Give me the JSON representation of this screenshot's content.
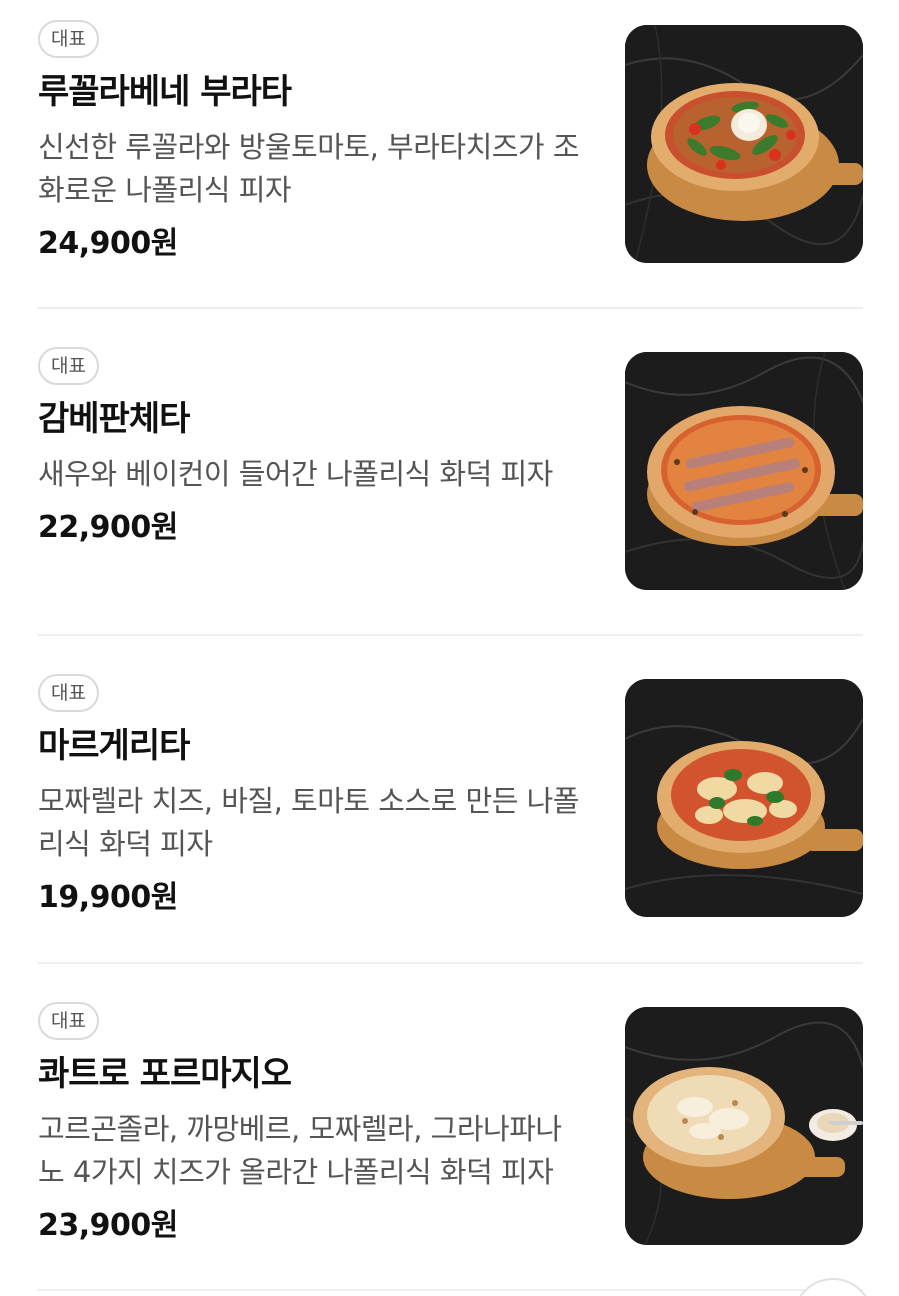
{
  "menu": {
    "items": [
      {
        "badge": "대표",
        "name": "루꼴라베네 부라타",
        "description": "신선한 루꼴라와 방울토마토, 부라타치즈가 조화로운 나폴리식 피자",
        "price": "24,900원",
        "image_icon": "rucola-burrata-pizza-photo"
      },
      {
        "badge": "대표",
        "name": "감베판체타",
        "description": "새우와 베이컨이 들어간 나폴리식 화덕 피자",
        "price": "22,900원",
        "image_icon": "gamberi-pancetta-pizza-photo"
      },
      {
        "badge": "대표",
        "name": "마르게리타",
        "description": "모짜렐라 치즈, 바질, 토마토 소스로 만든 나폴리식 화덕 피자",
        "price": "19,900원",
        "image_icon": "margherita-pizza-photo"
      },
      {
        "badge": "대표",
        "name": "콰트로 포르마지오",
        "description": "고르곤졸라, 까망베르, 모짜렐라, 그라나파나노 4가지 치즈가 올라간 나폴리식 화덕 피자",
        "price": "23,900원",
        "image_icon": "quattro-formaggi-pizza-photo"
      }
    ]
  },
  "colors": {
    "background": "#ffffff",
    "text_primary": "#111111",
    "text_secondary": "#555555",
    "badge_border": "#d9d9d9",
    "divider": "#eeeeee",
    "photo_background": "#1a1a1a",
    "board_wood": "#d9a35a",
    "crust": "#e8b878",
    "tomato_sauce": "#d2542e",
    "cheese": "#f1d9a3",
    "basil": "#2f7a2a",
    "rucola": "#3c7a2c"
  }
}
